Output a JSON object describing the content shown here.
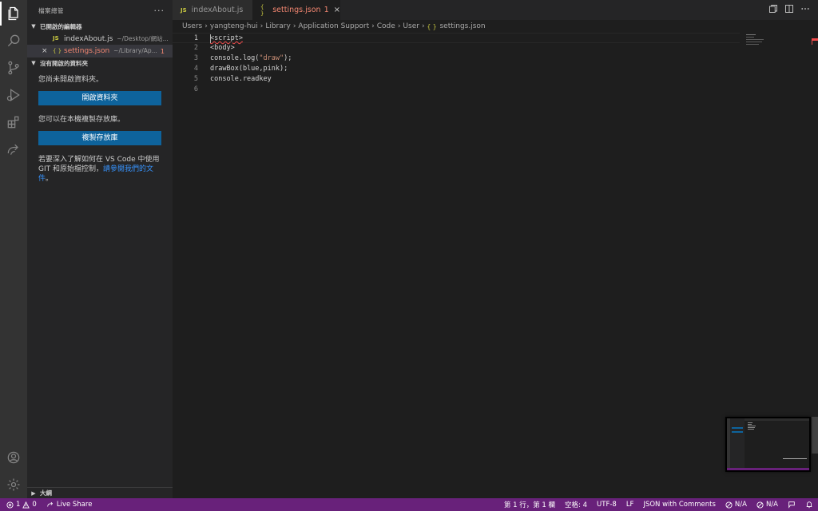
{
  "colors": {
    "status_bar": "#68217a",
    "button": "#0e639c",
    "error": "#f48771",
    "link": "#3794ff"
  },
  "activity_bar": {
    "top": [
      "files-icon",
      "search-icon",
      "source-control-icon",
      "run-debug-icon",
      "extensions-icon",
      "live-share-icon"
    ],
    "bottom": [
      "account-icon",
      "gear-icon"
    ]
  },
  "sidebar": {
    "title": "檔案總管",
    "more": "···",
    "open_editors": {
      "title": "已開啟的編輯器",
      "items": [
        {
          "icon": "JS",
          "name": "indexAbout.js",
          "path": "~/Desktop/網站...",
          "selected": false,
          "error": false,
          "badge": ""
        },
        {
          "icon": "{ }",
          "name": "settings.json",
          "path": "~/Library/Ap...",
          "selected": true,
          "error": true,
          "badge": "1"
        }
      ]
    },
    "no_folder": {
      "title": "沒有開啟的資料夾",
      "msg1": "您尚未開啟資料夾。",
      "btn_open": "開啟資料夾",
      "msg2": "您可以在本機複製存放庫。",
      "btn_clone": "複製存放庫",
      "msg3": "若要深入了解如何在 VS Code 中使用 GIT 和原始檔控制，",
      "link": "請參閱我們的文件",
      "msg3_end": "。"
    },
    "outline": "大綱"
  },
  "tabs": [
    {
      "icon": "JS",
      "label": "indexAbout.js",
      "active": false,
      "badge": ""
    },
    {
      "icon": "{ }",
      "label": "settings.json",
      "active": true,
      "badge": "1"
    }
  ],
  "tab_close": "×",
  "breadcrumb": {
    "parts": [
      "Users",
      "yangteng-hui",
      "Library",
      "Application Support",
      "Code",
      "User"
    ],
    "file_icon": "{ }",
    "file": "settings.json"
  },
  "editor": {
    "lines": [
      {
        "n": "1",
        "text": "<script>"
      },
      {
        "n": "2",
        "text": "<body>"
      },
      {
        "n": "3",
        "pre": "console.log(",
        "str": "\"draw\"",
        "post": ");"
      },
      {
        "n": "4",
        "text": "drawBox(blue,pink);"
      },
      {
        "n": "5",
        "text": "console.readkey"
      },
      {
        "n": "6",
        "text": ""
      }
    ]
  },
  "status": {
    "errors": "1",
    "warnings": "0",
    "live_share": "Live Share",
    "position": "第 1 行，第 1 欄",
    "spaces": "空格: 4",
    "encoding": "UTF-8",
    "eol": "LF",
    "language": "JSON with Comments",
    "na1": "N/A",
    "na2": "N/A"
  }
}
